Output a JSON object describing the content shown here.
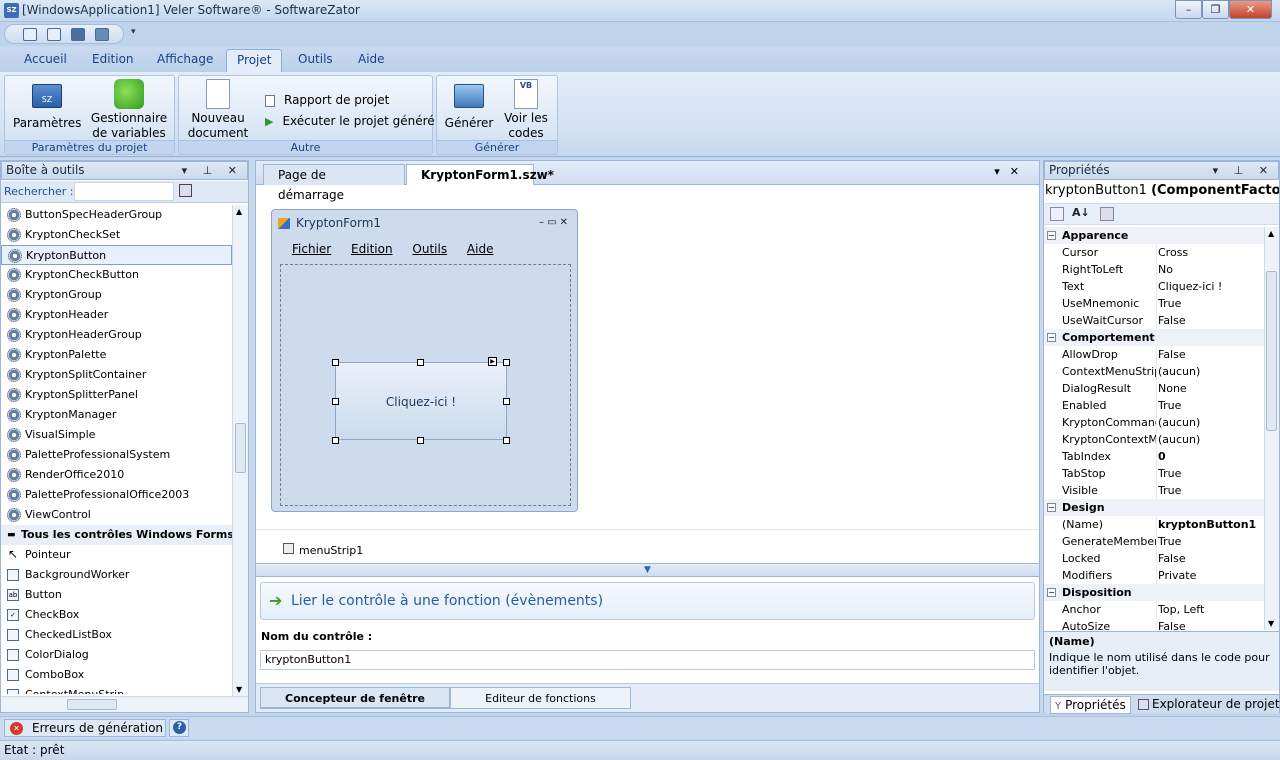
{
  "window": {
    "title": "[WindowsApplication1] Veler Software® - SoftwareZator",
    "app_icon": "SZ"
  },
  "ribbon": {
    "tabs": [
      "Accueil",
      "Edition",
      "Affichage",
      "Projet",
      "Outils",
      "Aide"
    ],
    "active_tab": "Projet",
    "groups": {
      "params": {
        "label": "Paramètres du projet",
        "parametres": "Paramètres",
        "gestionnaire_l1": "Gestionnaire",
        "gestionnaire_l2": "de variables"
      },
      "autre": {
        "label": "Autre",
        "nouveau_l1": "Nouveau",
        "nouveau_l2": "document",
        "rapport": "Rapport de projet",
        "executer": "Exécuter le projet généré"
      },
      "generer": {
        "label": "Générer",
        "generer_btn": "Générer",
        "voir_l1": "Voir les",
        "voir_l2": "codes"
      }
    }
  },
  "toolbox": {
    "title": "Boîte à outils",
    "search_label": "Rechercher :",
    "items": [
      "ButtonSpecHeaderGroup",
      "KryptonCheckSet",
      "KryptonButton",
      "KryptonCheckButton",
      "KryptonGroup",
      "KryptonHeader",
      "KryptonHeaderGroup",
      "KryptonPalette",
      "KryptonSplitContainer",
      "KryptonSplitterPanel",
      "KryptonManager",
      "VisualSimple",
      "PaletteProfessionalSystem",
      "RenderOffice2010",
      "PaletteProfessionalOffice2003",
      "ViewControl"
    ],
    "selected": "KryptonButton",
    "section": "Tous les contrôles Windows Forms",
    "win_items": [
      "Pointeur",
      "BackgroundWorker",
      "Button",
      "CheckBox",
      "CheckedListBox",
      "ColorDialog",
      "ComboBox",
      "ContextMenuStrip"
    ]
  },
  "doc_tabs": [
    "Page de démarrage",
    "KryptonForm1.szw*"
  ],
  "active_doc_tab": "KryptonForm1.szw*",
  "designer": {
    "form_title": "KryptonForm1",
    "menu": [
      "Fichier",
      "Edition",
      "Outils",
      "Aide"
    ],
    "button_text": "Cliquez-ici !",
    "component": "menuStrip1"
  },
  "events": {
    "lier": "Lier le contrôle à une fonction (évènements)",
    "nom_label": "Nom du contrôle :",
    "nom_value": "kryptonButton1"
  },
  "bottom_tabs": [
    "Concepteur de fenêtre",
    "Editeur de fonctions"
  ],
  "properties": {
    "title": "Propriétés",
    "selected_object": "kryptonButton1",
    "selected_type": "(ComponentFacto",
    "rows": [
      {
        "cat": "Apparence"
      },
      {
        "n": "Cursor",
        "v": "Cross"
      },
      {
        "n": "RightToLeft",
        "v": "No"
      },
      {
        "n": "Text",
        "v": "Cliquez-ici !"
      },
      {
        "n": "UseMnemonic",
        "v": "True"
      },
      {
        "n": "UseWaitCursor",
        "v": "False"
      },
      {
        "cat": "Comportement"
      },
      {
        "n": "AllowDrop",
        "v": "False"
      },
      {
        "n": "ContextMenuStrip",
        "v": "(aucun)"
      },
      {
        "n": "DialogResult",
        "v": "None"
      },
      {
        "n": "Enabled",
        "v": "True"
      },
      {
        "n": "KryptonCommand",
        "v": "(aucun)"
      },
      {
        "n": "KryptonContextMe",
        "v": "(aucun)"
      },
      {
        "n": "TabIndex",
        "v": "0",
        "bold": true
      },
      {
        "n": "TabStop",
        "v": "True"
      },
      {
        "n": "Visible",
        "v": "True"
      },
      {
        "cat": "Design"
      },
      {
        "n": "(Name)",
        "v": "kryptonButton1",
        "bold": true
      },
      {
        "n": "GenerateMember",
        "v": "True"
      },
      {
        "n": "Locked",
        "v": "False"
      },
      {
        "n": "Modifiers",
        "v": "Private"
      },
      {
        "cat": "Disposition"
      },
      {
        "n": "Anchor",
        "v": "Top, Left"
      },
      {
        "n": "AutoSize",
        "v": "False"
      }
    ],
    "desc_title": "(Name)",
    "desc_text": "Indique le nom utilisé dans le code pour identifier l'objet.",
    "tabs": [
      "Propriétés",
      "Explorateur de projet"
    ]
  },
  "errors_tab": "Erreurs de génération",
  "status": "Etat : prêt"
}
